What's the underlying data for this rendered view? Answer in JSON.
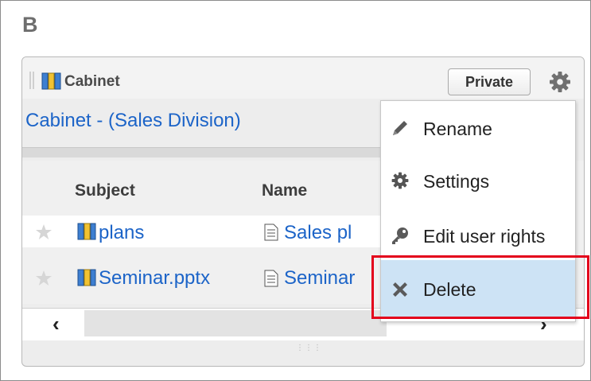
{
  "section": {
    "letter": "B"
  },
  "portlet": {
    "title": "Cabinet",
    "private_label": "Private",
    "folder_link": "Cabinet - (Sales Division)"
  },
  "table": {
    "headers": [
      "Subject",
      "Name"
    ],
    "rows": [
      {
        "subject": "plans",
        "name": "Sales pl"
      },
      {
        "subject": "Seminar.pptx",
        "name": "Seminar"
      }
    ]
  },
  "menu": {
    "items": [
      {
        "label": "Rename",
        "icon": "pencil-icon"
      },
      {
        "label": "Settings",
        "icon": "gear-icon"
      },
      {
        "label": "Edit user rights",
        "icon": "key-icon"
      },
      {
        "label": "Delete",
        "icon": "x-icon"
      }
    ],
    "highlighted": "Delete"
  },
  "colors": {
    "link": "#1c64c8",
    "highlight_border": "#e3001b",
    "menu_hover": "#cde3f5"
  }
}
